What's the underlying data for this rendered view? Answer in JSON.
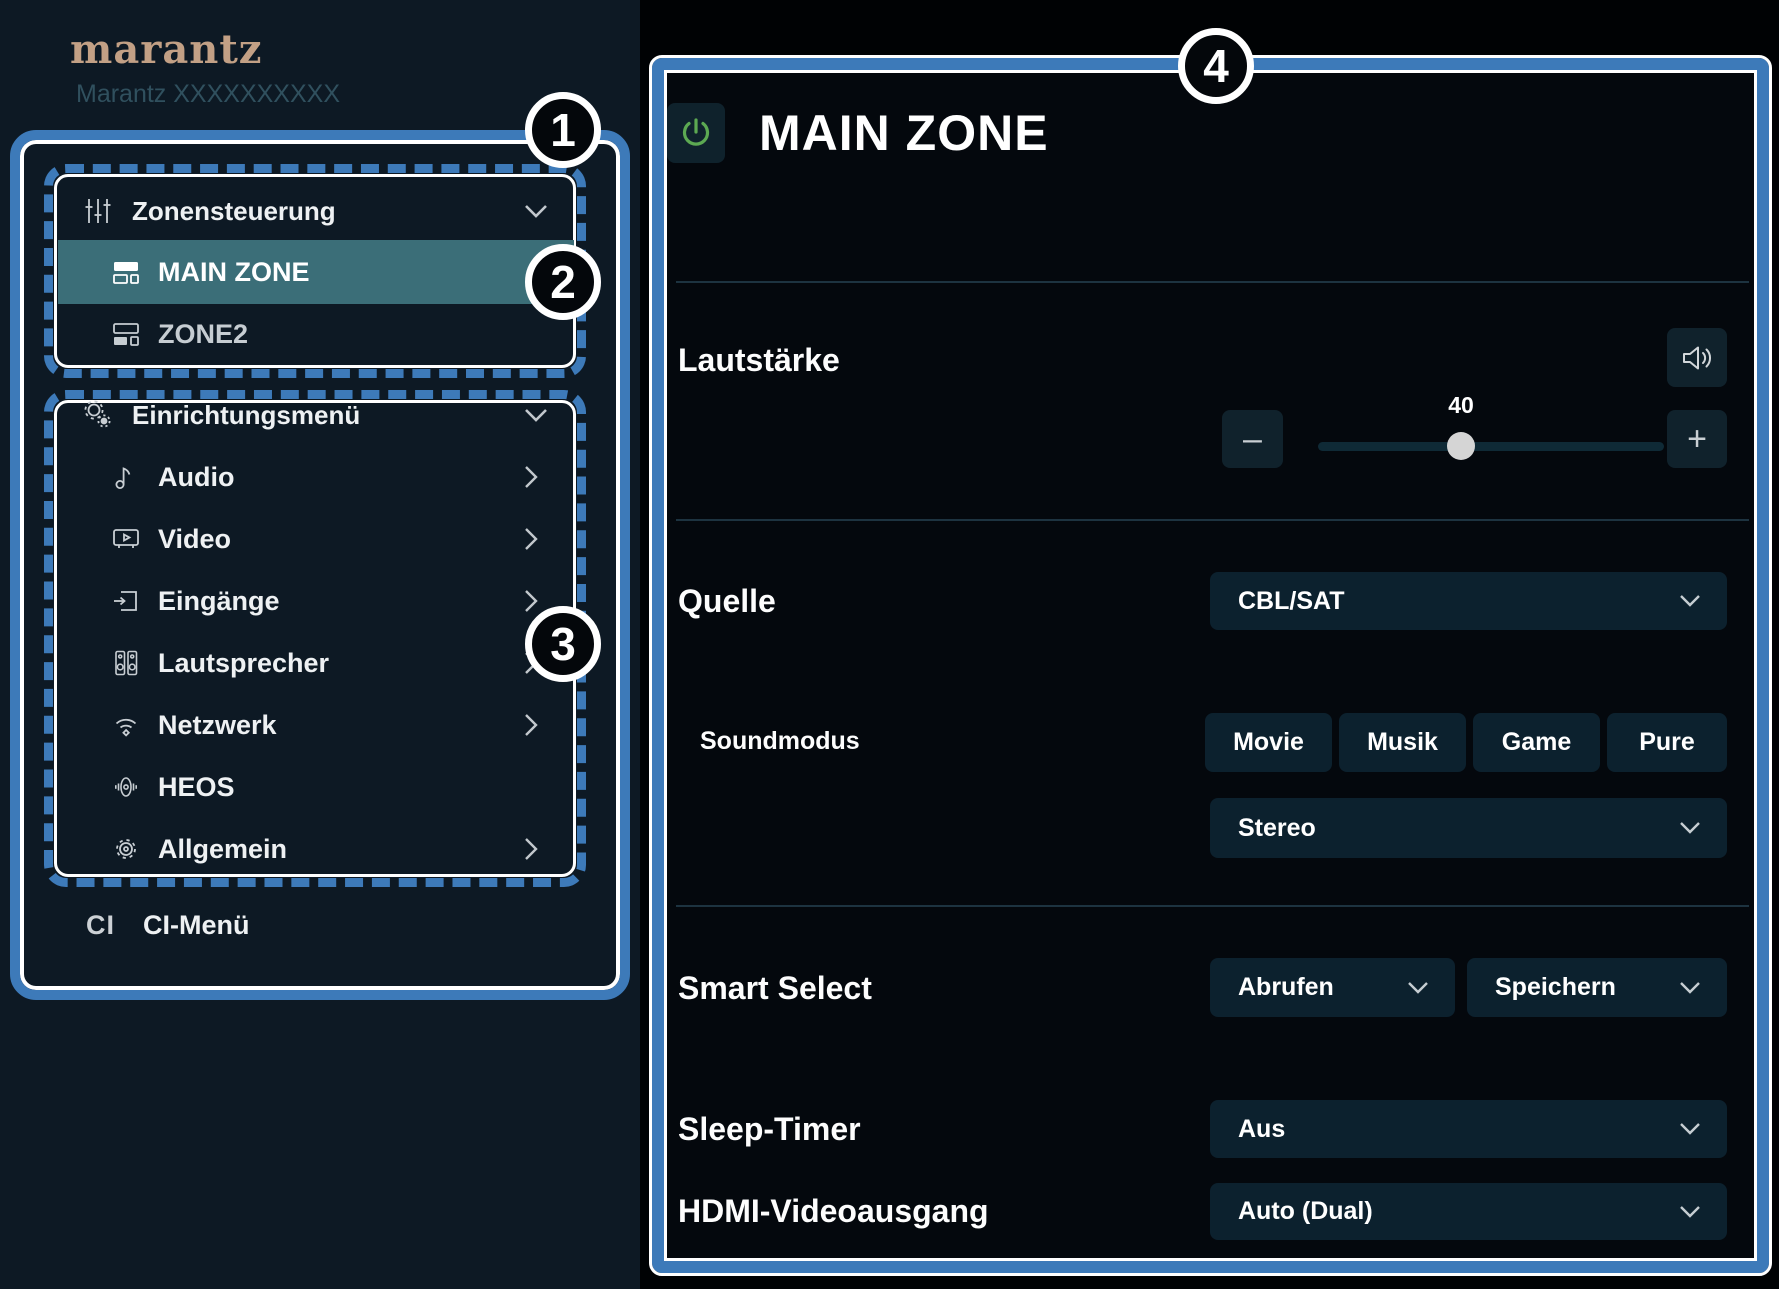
{
  "sidebar": {
    "logo": "marantz",
    "model": "Marantz XXXXXXXXXX",
    "zone_menu": {
      "header": "Zonensteuerung",
      "items": [
        {
          "label": "MAIN ZONE",
          "selected": true
        },
        {
          "label": "ZONE2",
          "selected": false
        }
      ]
    },
    "setup_menu": {
      "header": "Einrichtungsmenü",
      "items": [
        "Audio",
        "Video",
        "Eingänge",
        "Lautsprecher",
        "Netzwerk",
        "HEOS",
        "Allgemein"
      ]
    },
    "ci_menu": {
      "icon_text": "CI",
      "label": "CI-Menü"
    }
  },
  "callouts": {
    "c1": "1",
    "c2": "2",
    "c3": "3",
    "c4": "4"
  },
  "main": {
    "title": "MAIN ZONE",
    "volume": {
      "label": "Lautstärke",
      "value": "40",
      "decrease_icon": "–",
      "increase_icon": "+"
    },
    "source": {
      "label": "Quelle",
      "value": "CBL/SAT"
    },
    "sound_mode": {
      "label": "Soundmodus",
      "buttons": [
        "Movie",
        "Musik",
        "Game",
        "Pure"
      ],
      "current": "Stereo"
    },
    "smart_select": {
      "label": "Smart Select",
      "recall": "Abrufen",
      "store": "Speichern"
    },
    "sleep_timer": {
      "label": "Sleep-Timer",
      "value": "Aus"
    },
    "hdmi_out": {
      "label": "HDMI-Videoausgang",
      "value": "Auto (Dual)"
    }
  },
  "colors": {
    "callout_blue": "#3d7ab9",
    "sidebar_bg": "#0d1924",
    "selected_zone_teal": "#3b6e78",
    "power_green": "#5CA952",
    "logo_tan": "#c2a085",
    "control_bg": "#0c212e"
  }
}
